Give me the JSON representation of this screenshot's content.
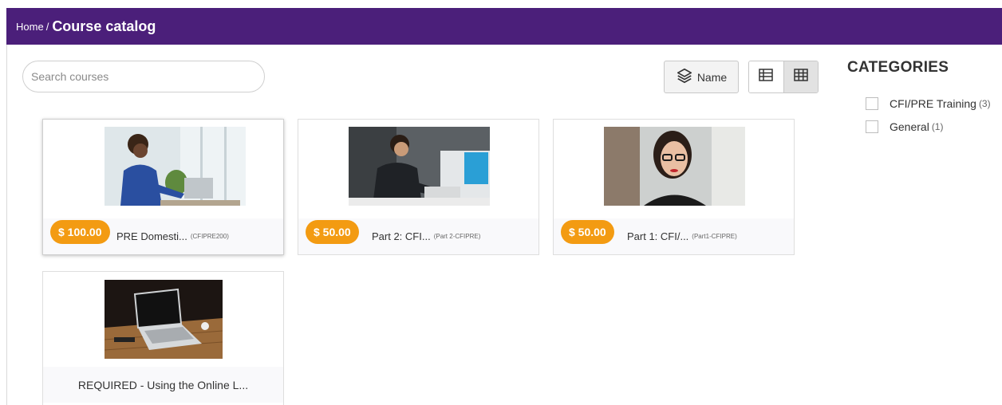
{
  "breadcrumb": {
    "home": "Home",
    "separator": "/",
    "current": "Course catalog"
  },
  "search": {
    "placeholder": "Search courses",
    "value": ""
  },
  "sort": {
    "label": "Name",
    "icon": "layers-icon"
  },
  "view_toggle": {
    "list_icon": "list-view-icon",
    "grid_icon": "grid-view-icon",
    "active": "grid"
  },
  "categories": {
    "title": "CATEGORIES",
    "items": [
      {
        "label": "CFI/PRE Training",
        "count": "(3)"
      },
      {
        "label": "General",
        "count": "(1)"
      }
    ]
  },
  "courses": [
    {
      "price": "$ 100.00",
      "title": "PRE Domesti...",
      "code": "(CFIPRE200)"
    },
    {
      "price": "$ 50.00",
      "title": "Part 2: CFI...",
      "code": "(Part 2-CFIPRE)"
    },
    {
      "price": "$ 50.00",
      "title": "Part 1: CFI/...",
      "code": "(Part1-CFIPRE)"
    },
    {
      "title": "REQUIRED - Using the Online L..."
    }
  ],
  "colors": {
    "header_bg": "#4b1f7a",
    "price_badge": "#f39b12"
  }
}
